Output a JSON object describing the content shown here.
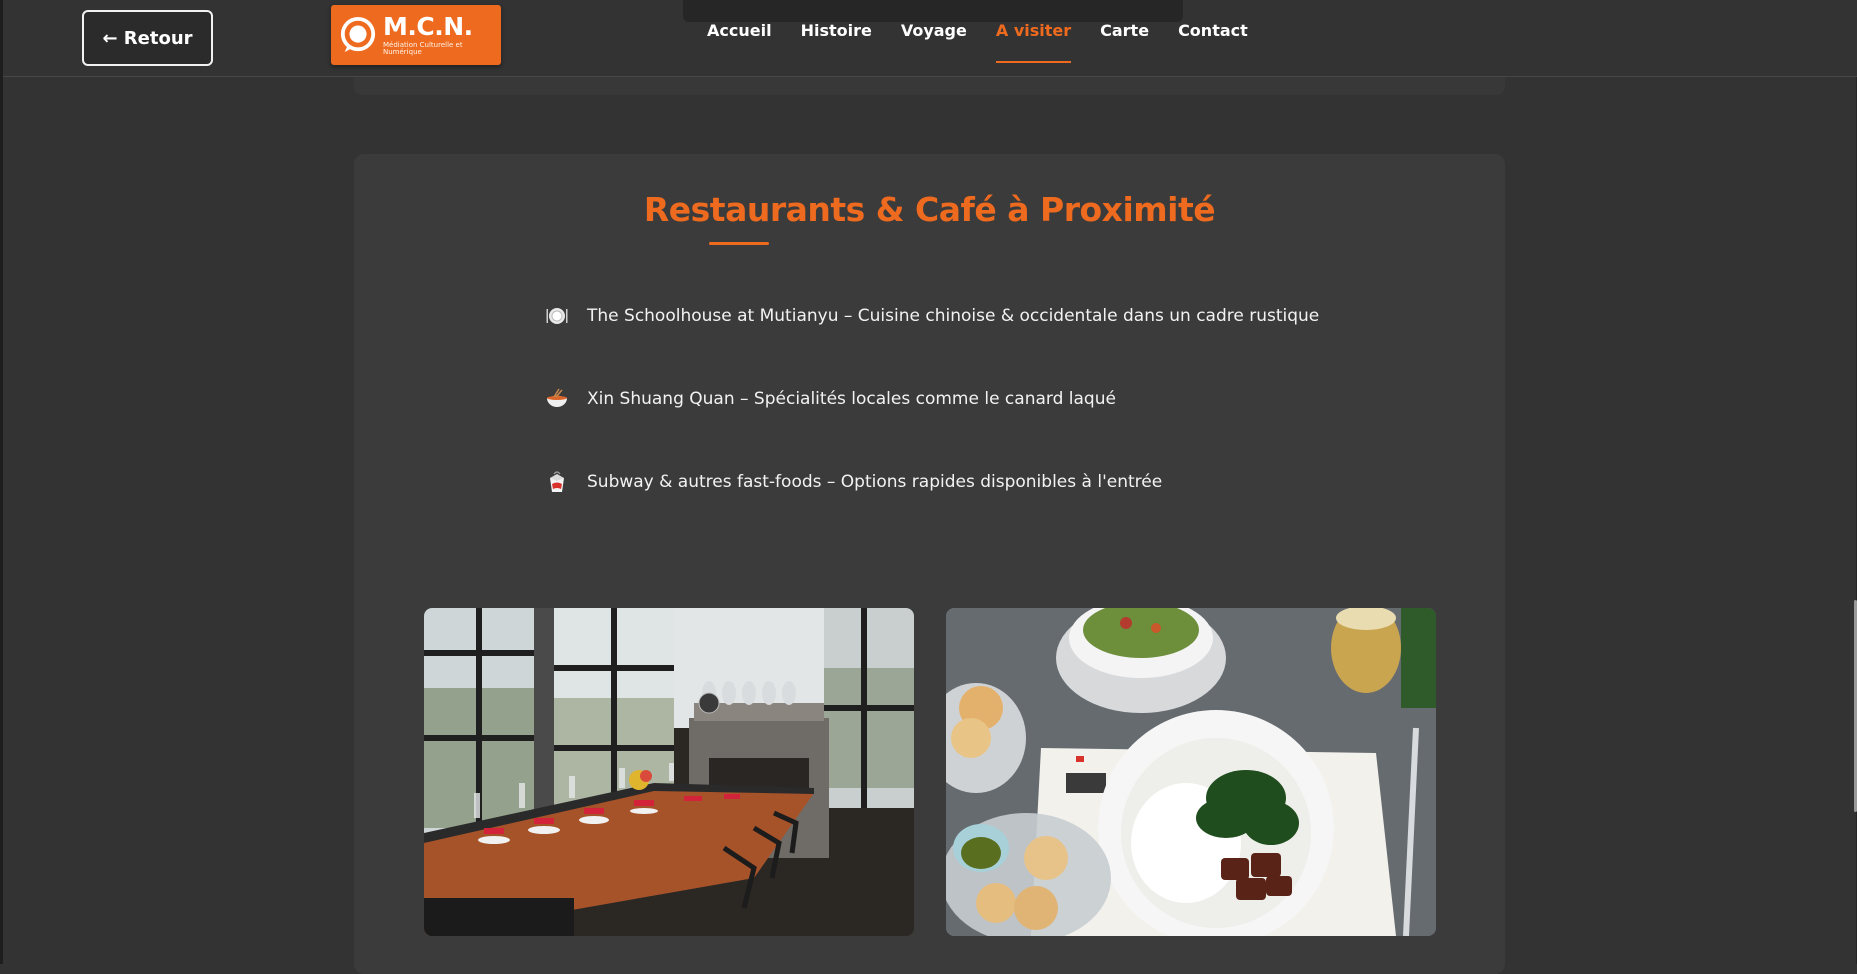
{
  "header": {
    "back_label": "← Retour",
    "logo": {
      "title": "M.C.N.",
      "subtitle": "Médiation Culturelle et Numérique"
    },
    "nav": [
      {
        "label": "Accueil",
        "active": false
      },
      {
        "label": "Histoire",
        "active": false
      },
      {
        "label": "Voyage",
        "active": false
      },
      {
        "label": "A visiter",
        "active": true
      },
      {
        "label": "Carte",
        "active": false
      },
      {
        "label": "Contact",
        "active": false
      }
    ]
  },
  "section": {
    "title": "Restaurants & Café à Proximité",
    "items": [
      {
        "icon": "plate-cutlery-icon",
        "text": "The Schoolhouse at Mutianyu – Cuisine chinoise & occidentale dans un cadre rustique"
      },
      {
        "icon": "noodle-bowl-icon",
        "text": "Xin Shuang Quan – Spécialités locales comme le canard laqué"
      },
      {
        "icon": "takeout-box-icon",
        "text": "Subway & autres fast-foods – Options rapides disponibles à l'entrée"
      }
    ]
  },
  "colors": {
    "accent": "#ee6a1f",
    "background": "#333333",
    "card": "#3b3b3b"
  }
}
